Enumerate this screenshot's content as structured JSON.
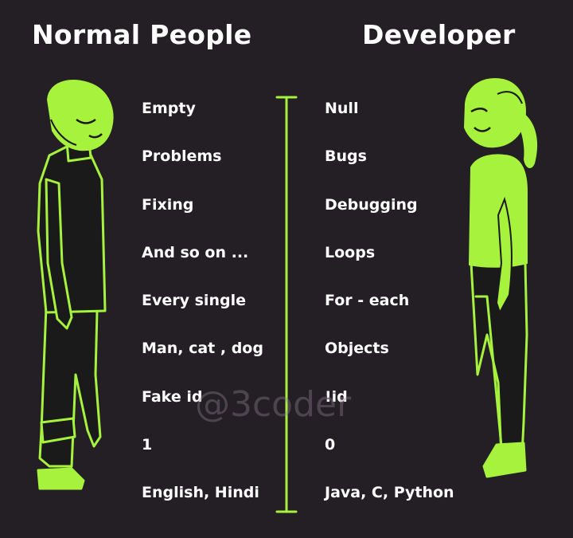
{
  "header": {
    "left": "Normal People",
    "right": "Developer"
  },
  "left_terms": [
    "Empty",
    "Problems",
    "Fixing",
    "And so on ...",
    "Every single",
    "Man, cat , dog",
    "Fake id",
    "1",
    "English, Hindi"
  ],
  "right_terms": [
    "Null",
    "Bugs",
    "Debugging",
    "Loops",
    "For - each",
    "Objects",
    "!id",
    "0",
    "Java, C, Python"
  ],
  "watermark": "@3coder",
  "colors": {
    "background": "#231f24",
    "accent": "#a6f23c",
    "text": "#ffffff"
  },
  "icons": {
    "left_figure": "man-figure-icon",
    "right_figure": "woman-figure-icon",
    "divider": "vertical-divider"
  }
}
